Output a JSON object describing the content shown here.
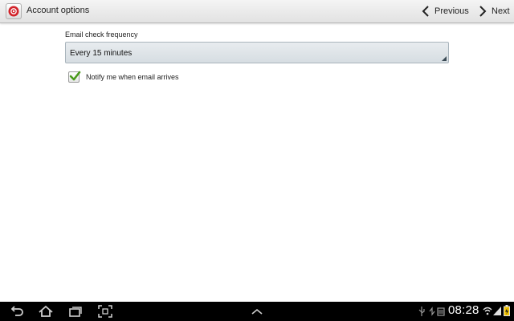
{
  "action_bar": {
    "title": "Account options",
    "previous_label": "Previous",
    "next_label": "Next"
  },
  "form": {
    "frequency_label": "Email check frequency",
    "frequency_value": "Every 15 minutes",
    "notify_label": "Notify me when email arrives",
    "notify_checked": true
  },
  "system_bar": {
    "time": "08:28",
    "nav_icons": [
      "back-icon",
      "home-icon",
      "recent-apps-icon",
      "screenshot-icon"
    ],
    "center_icon": "chevron-up-icon",
    "status_icons": [
      "usb-icon",
      "sync-icon",
      "storage-icon",
      "wifi-icon",
      "signal-icon",
      "battery-icon"
    ]
  },
  "colors": {
    "accent_green": "#4a9a1c",
    "app_icon_red": "#d2232a",
    "spinner_bg": "#dde3e7"
  }
}
